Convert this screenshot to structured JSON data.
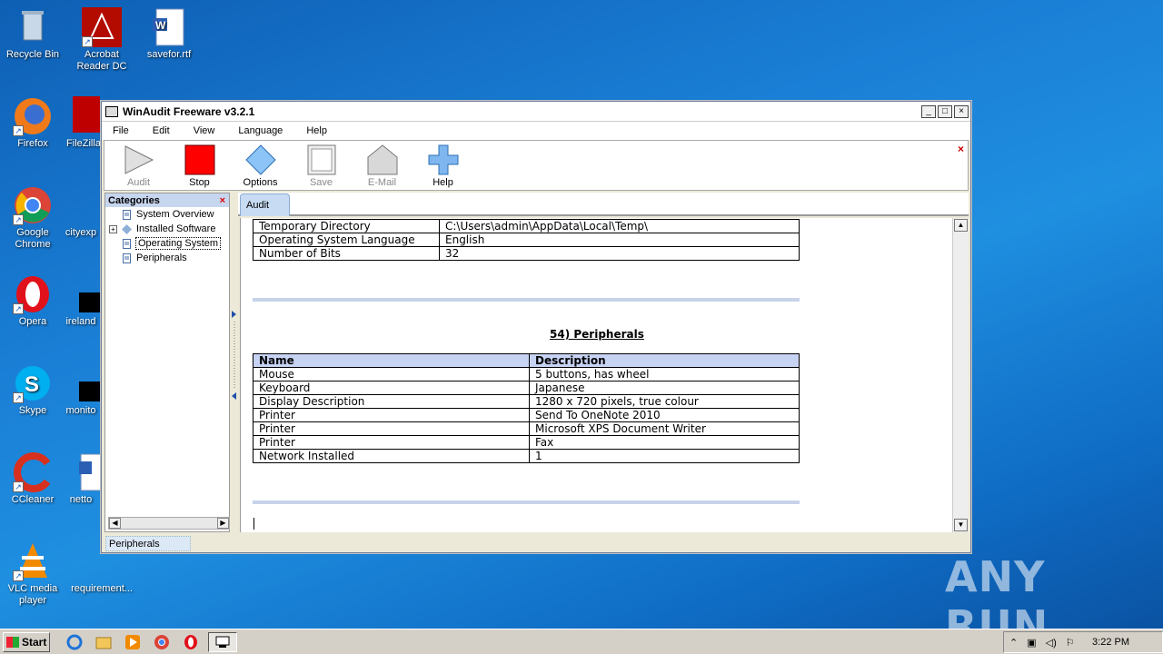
{
  "desktop": {
    "icons": [
      {
        "label": "Recycle Bin"
      },
      {
        "label": "Acrobat Reader DC"
      },
      {
        "label": "savefor.rtf"
      },
      {
        "label": "Firefox"
      },
      {
        "label": "FileZilla"
      },
      {
        "label": "Google Chrome"
      },
      {
        "label": "cityexp"
      },
      {
        "label": "Opera"
      },
      {
        "label": "ireland"
      },
      {
        "label": "Skype"
      },
      {
        "label": "monito"
      },
      {
        "label": "CCleaner"
      },
      {
        "label": "netto"
      },
      {
        "label": "VLC media player"
      },
      {
        "label": "requirement..."
      }
    ]
  },
  "window": {
    "title": "WinAudit Freeware v3.2.1",
    "buttons": {
      "minimize": "_",
      "maximize": "□",
      "close": "×"
    }
  },
  "menu": [
    {
      "label": "File"
    },
    {
      "label": "Edit"
    },
    {
      "label": "View"
    },
    {
      "label": "Language"
    },
    {
      "label": "Help"
    }
  ],
  "toolbar": {
    "close": "×",
    "buttons": [
      {
        "label": "Audit",
        "enabled": false
      },
      {
        "label": "Stop",
        "enabled": true
      },
      {
        "label": "Options",
        "enabled": true
      },
      {
        "label": "Save",
        "enabled": false
      },
      {
        "label": "E-Mail",
        "enabled": false
      },
      {
        "label": "Help",
        "enabled": true
      }
    ]
  },
  "categories": {
    "header": "Categories",
    "close": "×",
    "items": [
      {
        "label": "System Overview",
        "expandable": false
      },
      {
        "label": "Installed Software",
        "expandable": true
      },
      {
        "label": "Operating System",
        "expandable": false,
        "selected": true
      },
      {
        "label": "Peripherals",
        "expandable": false
      }
    ]
  },
  "tabs": [
    {
      "label": "Audit"
    }
  ],
  "report": {
    "os_rows": [
      [
        "Temporary Directory",
        "C:\\Users\\admin\\AppData\\Local\\Temp\\"
      ],
      [
        "Operating System Language",
        "English"
      ],
      [
        "Number of Bits",
        "32"
      ]
    ],
    "section_title": "54) Peripherals",
    "peripherals_header": [
      "Name",
      "Description"
    ],
    "peripherals_rows": [
      [
        "Mouse",
        "5 buttons, has wheel"
      ],
      [
        "Keyboard",
        "Japanese"
      ],
      [
        "Display Description",
        "1280 x 720 pixels, true colour"
      ],
      [
        "Printer",
        "Send To OneNote 2010"
      ],
      [
        "Printer",
        "Microsoft XPS Document Writer"
      ],
      [
        "Printer",
        "Fax"
      ],
      [
        "Network Installed",
        "1"
      ]
    ]
  },
  "status": {
    "text": "Peripherals"
  },
  "taskbar": {
    "start": "Start",
    "clock": "3:22 PM"
  },
  "watermark": "ANY RUN"
}
